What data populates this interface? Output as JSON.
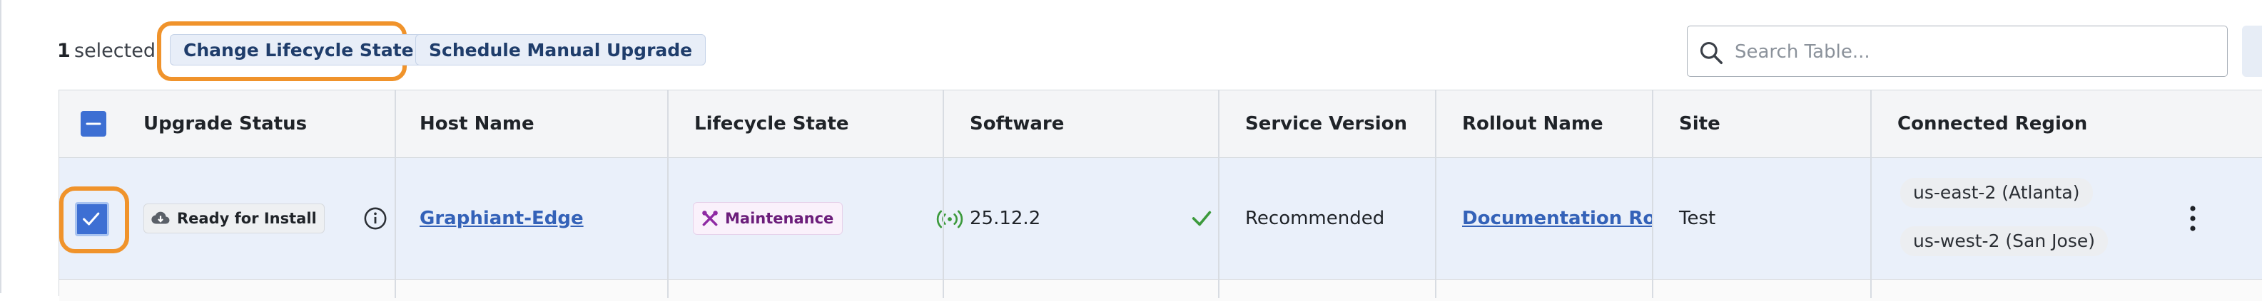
{
  "toolbar": {
    "selected_count": "1",
    "selected_label": "selected",
    "change_lifecycle_label": "Change Lifecycle State",
    "schedule_upgrade_label": "Schedule Manual Upgrade",
    "search_placeholder": "Search Table...",
    "more_icon": "vertical-dots-icon"
  },
  "table": {
    "columns": [
      "Upgrade Status",
      "Host Name",
      "Lifecycle State",
      "Software",
      "Service Version",
      "Rollout Name",
      "Site",
      "Connected Region"
    ],
    "rows": [
      {
        "upgrade_status": "Ready for Install",
        "host_name": "Graphiant-Edge",
        "lifecycle_state": "Maintenance",
        "software": "25.12.2",
        "service_version": "Recommended",
        "rollout_name": "Documentation Rollout",
        "site": "Test",
        "regions": [
          "us-east-2 (Atlanta)",
          "us-west-2 (San Jose)"
        ]
      }
    ]
  },
  "colors": {
    "accent_blue": "#3d6fd3",
    "highlight_orange": "#f0932b",
    "success_green": "#3c9a3c",
    "maintenance_purple": "#8e2aa3"
  }
}
